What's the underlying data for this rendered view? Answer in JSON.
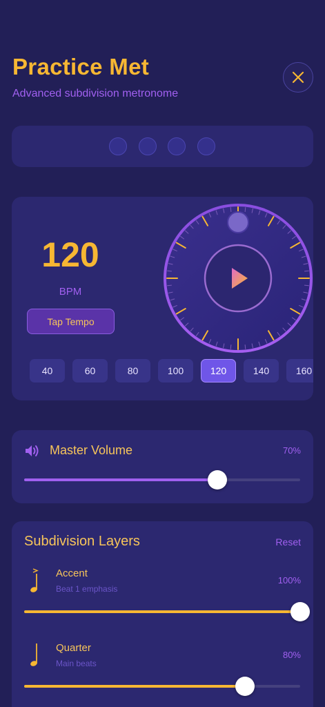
{
  "header": {
    "title": "Practice Met",
    "subtitle": "Advanced subdivision metronome",
    "close_icon": "close-icon"
  },
  "beats": {
    "count": 4
  },
  "tempo": {
    "bpm": "120",
    "bpm_label": "BPM",
    "tap_label": "Tap Tempo",
    "play_icon": "play-icon",
    "presets": [
      "40",
      "60",
      "80",
      "100",
      "120",
      "140",
      "160"
    ],
    "active_preset": "120"
  },
  "volume": {
    "icon": "speaker-icon",
    "label": "Master Volume",
    "percent_text": "70%",
    "level": 0.7
  },
  "subdivisions": {
    "title": "Subdivision Layers",
    "reset_label": "Reset",
    "layers": [
      {
        "icon": "accent-note-icon",
        "name": "Accent",
        "description": "Beat 1 emphasis",
        "percent_text": "100%",
        "level": 1.0
      },
      {
        "icon": "quarter-note-icon",
        "name": "Quarter",
        "description": "Main beats",
        "percent_text": "80%",
        "level": 0.8
      }
    ]
  },
  "colors": {
    "background": "#221f57",
    "card": "#2c2870",
    "accent_gold": "#f7b733",
    "accent_purple": "#a160f0"
  }
}
